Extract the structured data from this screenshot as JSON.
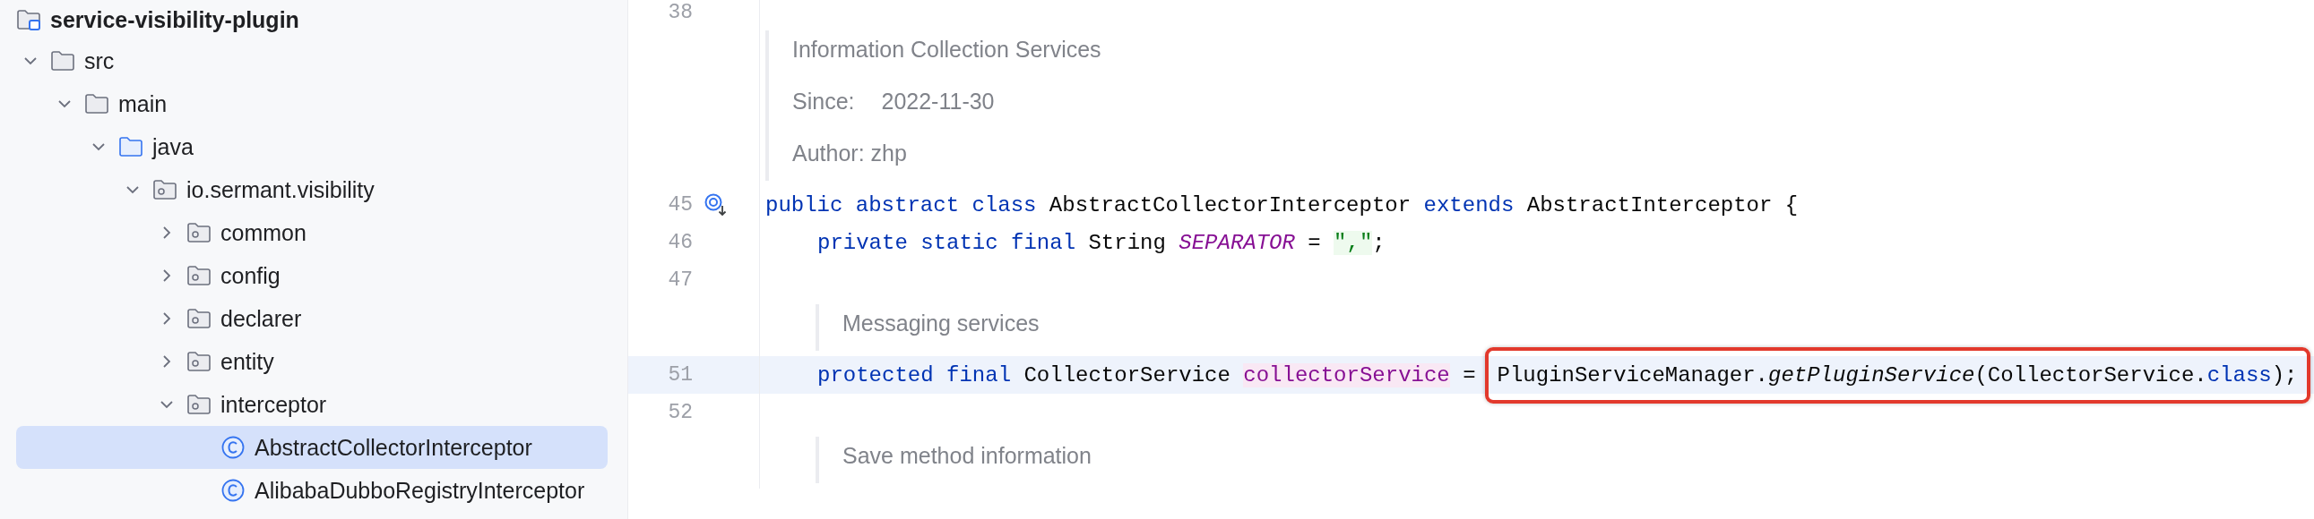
{
  "project_tree": {
    "root": {
      "label": "service-visibility-plugin",
      "kind": "module",
      "children": [
        {
          "label": "src",
          "kind": "folder",
          "expanded": true,
          "selected": false,
          "children": [
            {
              "label": "main",
              "kind": "folder",
              "expanded": true,
              "selected": false,
              "children": [
                {
                  "label": "java",
                  "kind": "source",
                  "expanded": true,
                  "selected": false,
                  "children": [
                    {
                      "label": "io.sermant.visibility",
                      "kind": "package",
                      "expanded": true,
                      "selected": false,
                      "children": [
                        {
                          "label": "common",
                          "kind": "package",
                          "expanded": false,
                          "selected": false
                        },
                        {
                          "label": "config",
                          "kind": "package",
                          "expanded": false,
                          "selected": false
                        },
                        {
                          "label": "declarer",
                          "kind": "package",
                          "expanded": false,
                          "selected": false
                        },
                        {
                          "label": "entity",
                          "kind": "package",
                          "expanded": false,
                          "selected": false
                        },
                        {
                          "label": "interceptor",
                          "kind": "package",
                          "expanded": true,
                          "selected": false,
                          "children": [
                            {
                              "label": "AbstractCollectorInterceptor",
                              "kind": "class",
                              "selected": true
                            },
                            {
                              "label": "AlibabaDubboRegistryInterceptor",
                              "kind": "class",
                              "selected": false
                            }
                          ]
                        }
                      ]
                    }
                  ]
                }
              ]
            }
          ]
        }
      ]
    }
  },
  "editor": {
    "lines": [
      {
        "kind": "code",
        "number": "38",
        "current": false
      },
      {
        "kind": "doc",
        "indented": false,
        "items": [
          {
            "kind": "text",
            "text": "Information Collection Services"
          },
          {
            "kind": "field",
            "label": "Since:",
            "value": "2022-11-30"
          },
          {
            "kind": "text",
            "text": "Author: zhp"
          }
        ]
      },
      {
        "kind": "code",
        "number": "45",
        "current": false,
        "indented": false,
        "implemented_marker": true,
        "tokens": [
          {
            "kind": "keyword",
            "text": "public abstract class"
          },
          {
            "kind": "plain",
            "text": " AbstractCollectorInterceptor "
          },
          {
            "kind": "keyword",
            "text": "extends"
          },
          {
            "kind": "plain",
            "text": " AbstractInterceptor {"
          }
        ]
      },
      {
        "kind": "code",
        "number": "46",
        "current": false,
        "indented": true,
        "tokens": [
          {
            "kind": "keyword",
            "text": "private static final"
          },
          {
            "kind": "plain",
            "text": " String "
          },
          {
            "kind": "constant",
            "text": "SEPARATOR"
          },
          {
            "kind": "plain",
            "text": " = "
          },
          {
            "kind": "string",
            "text": "\",\""
          },
          {
            "kind": "plain",
            "text": ";"
          }
        ]
      },
      {
        "kind": "code",
        "number": "47",
        "current": false
      },
      {
        "kind": "doc",
        "indented": true,
        "items": [
          {
            "kind": "text",
            "text": "Messaging services"
          }
        ]
      },
      {
        "kind": "code",
        "number": "51",
        "current": true,
        "indented": true,
        "tokens": [
          {
            "kind": "keyword",
            "text": "protected final"
          },
          {
            "kind": "plain",
            "text": " CollectorService "
          },
          {
            "kind": "field",
            "text": "collectorService"
          },
          {
            "kind": "plain",
            "text": " ="
          }
        ],
        "boxed_tokens": [
          {
            "kind": "plain",
            "text": "PluginServiceManager."
          },
          {
            "kind": "method",
            "text": "getPluginService"
          },
          {
            "kind": "plain",
            "text": "(CollectorService."
          },
          {
            "kind": "keyword",
            "text": "class"
          },
          {
            "kind": "plain",
            "text": ");"
          }
        ]
      },
      {
        "kind": "code",
        "number": "52",
        "current": false
      },
      {
        "kind": "doc",
        "indented": true,
        "items": [
          {
            "kind": "text",
            "text": "Save method information"
          }
        ]
      }
    ]
  }
}
